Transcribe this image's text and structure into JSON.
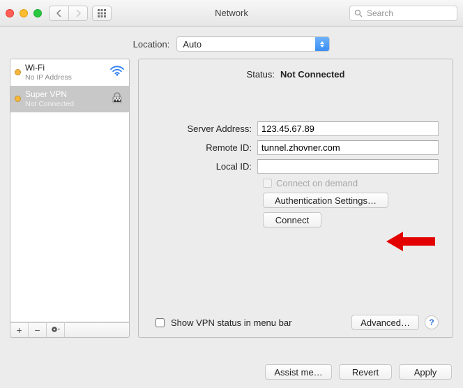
{
  "window": {
    "title": "Network"
  },
  "search": {
    "placeholder": "Search"
  },
  "location": {
    "label": "Location:",
    "value": "Auto"
  },
  "sidebar": {
    "items": [
      {
        "name": "Wi-Fi",
        "sub": "No IP Address"
      },
      {
        "name": "Super VPN",
        "sub": "Not Connected"
      }
    ]
  },
  "status": {
    "label": "Status:",
    "value": "Not Connected"
  },
  "form": {
    "server_label": "Server Address:",
    "server_value": "123.45.67.89",
    "remote_label": "Remote ID:",
    "remote_value": "tunnel.zhovner.com",
    "local_label": "Local ID:",
    "local_value": "",
    "connect_on_demand": "Connect on demand",
    "auth_btn": "Authentication Settings…",
    "connect_btn": "Connect"
  },
  "footer": {
    "show_status": "Show VPN status in menu bar",
    "advanced": "Advanced…"
  },
  "bottom": {
    "assist": "Assist me…",
    "revert": "Revert",
    "apply": "Apply"
  }
}
